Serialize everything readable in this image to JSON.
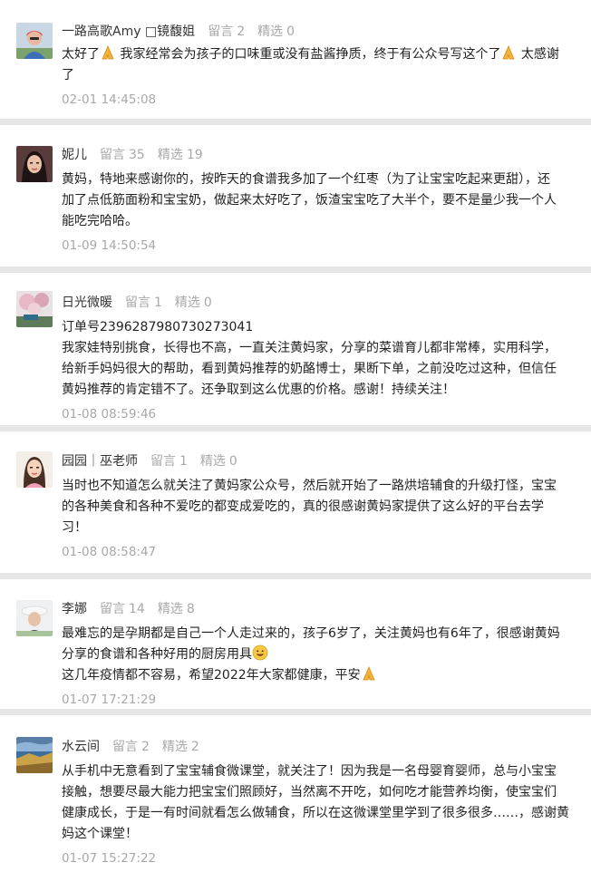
{
  "comments": [
    {
      "user": "一路高歌Amy □镜馥姐",
      "stats": {
        "reply_label": "留言",
        "reply_count": "2",
        "pick_label": "精选",
        "pick_count": "0"
      },
      "lines": [
        {
          "parts": [
            "太好了",
            "[pray]",
            " 我家经常会为孩子的口味重或没有盐酱挣质，终于有公众号写这个了",
            "[pray]",
            " 太感谢"
          ]
        },
        {
          "parts": [
            "了"
          ]
        }
      ],
      "time": "02-01 14:45:08",
      "avatar_icon": "avatar-person-red-icon"
    },
    {
      "user": "妮儿",
      "stats": {
        "reply_label": "留言",
        "reply_count": "35",
        "pick_label": "精选",
        "pick_count": "19"
      },
      "lines": [
        {
          "parts": [
            "黄妈，特地来感谢你的，按昨天的食谱我多加了一个红枣（为了让宝宝吃起来更甜），还"
          ]
        },
        {
          "parts": [
            "加了点低筋面粉和宝宝奶，做起来太好吃了，饭渣宝宝吃了大半个，要不是量少我一个人"
          ]
        },
        {
          "parts": [
            "能吃完哈哈。"
          ]
        }
      ],
      "time": "01-09 14:50:54",
      "avatar_icon": "avatar-woman-dark-icon"
    },
    {
      "user": "日光微暖",
      "stats": {
        "reply_label": "留言",
        "reply_count": "1",
        "pick_label": "精选",
        "pick_count": "0"
      },
      "lines": [
        {
          "parts": [
            "订单号2396287980730273041"
          ]
        },
        {
          "parts": [
            "我家娃特别挑食，长得也不高，一直关注黄妈家，分享的菜谱育儿都非常棒，实用科学，"
          ]
        },
        {
          "parts": [
            "给新手妈妈很大的帮助，看到黄妈推荐的奶酪博士，果断下单，之前没吃过这种，但信任"
          ]
        },
        {
          "parts": [
            "黄妈推荐的肯定错不了。还争取到这么优惠的价格。感谢！持续关注！"
          ]
        }
      ],
      "time": "01-08 08:59:46",
      "avatar_icon": "avatar-landscape-pink-icon"
    },
    {
      "user": "园园｜巫老师",
      "stats": {
        "reply_label": "留言",
        "reply_count": "1",
        "pick_label": "精选",
        "pick_count": "0"
      },
      "lines": [
        {
          "parts": [
            "当时也不知道怎么就关注了黄妈家公众号，然后就开始了一路烘培辅食的升级打怪，宝宝"
          ]
        },
        {
          "parts": [
            "的各种美食和各种不爱吃的都变成爱吃的，真的很感谢黄妈家提供了这么好的平台去学"
          ]
        },
        {
          "parts": [
            "习！"
          ]
        }
      ],
      "time": "01-08 08:58:47",
      "avatar_icon": "avatar-woman-light-icon"
    },
    {
      "user": "李娜",
      "stats": {
        "reply_label": "留言",
        "reply_count": "14",
        "pick_label": "精选",
        "pick_count": "8"
      },
      "lines": [
        {
          "parts": [
            "最难忘的是孕期都是自己一个人走过来的，孩子6岁了，关注黄妈也有6年了，很感谢黄妈"
          ]
        },
        {
          "parts": [
            "分享的食谱和各种好用的厨房用具",
            "[smile]"
          ]
        },
        {
          "parts": [
            "这几年疫情都不容易，希望2022年大家都健康，平安",
            "[pray]"
          ]
        }
      ],
      "time": "01-07 17:21:29",
      "avatar_icon": "avatar-person-hat-icon"
    },
    {
      "user": "水云间",
      "stats": {
        "reply_label": "留言",
        "reply_count": "2",
        "pick_label": "精选",
        "pick_count": "2"
      },
      "lines": [
        {
          "parts": [
            "从手机中无意看到了宝宝辅食微课堂，就关注了！因为我是一名母婴育婴师，总与小宝宝"
          ]
        },
        {
          "parts": [
            "接触，想要尽最大能力把宝宝们照顾好，当然离不开吃，如何吃才能营养均衡，使宝宝们"
          ]
        },
        {
          "parts": [
            "健康成长，于是一有时间就看怎么做辅食，所以在这微课堂里学到了很多很多……，感谢黄"
          ]
        },
        {
          "parts": [
            "妈这个课堂！"
          ]
        }
      ],
      "time": "01-07 15:27:22",
      "avatar_icon": "avatar-lake-landscape-icon"
    }
  ]
}
